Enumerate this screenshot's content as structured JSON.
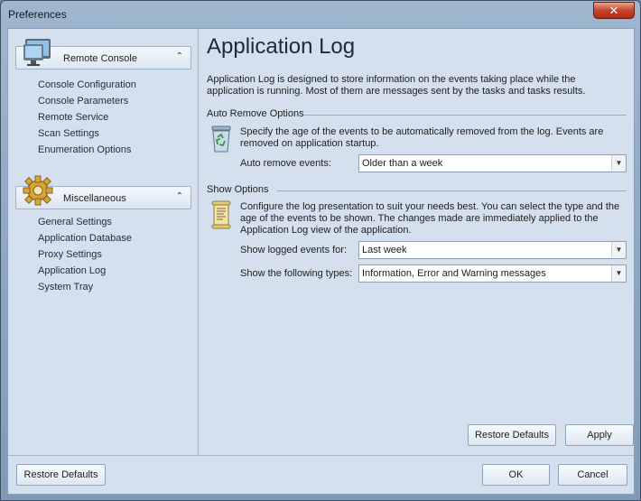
{
  "window": {
    "title": "Preferences",
    "close_label": "✕"
  },
  "sidebar": {
    "groups": [
      {
        "label": "Remote Console",
        "icon": "monitor-icon",
        "items": [
          "Console Configuration",
          "Console Parameters",
          "Remote Service",
          "Scan Settings",
          "Enumeration Options"
        ]
      },
      {
        "label": "Miscellaneous",
        "icon": "gear-icon",
        "items": [
          "General Settings",
          "Application Database",
          "Proxy Settings",
          "Application Log",
          "System Tray"
        ]
      }
    ],
    "collapse_glyph": "⌃"
  },
  "main": {
    "title": "Application Log",
    "description": "Application Log is designed to store information on the events taking place while the application is running. Most of them are messages sent by the tasks and tasks results.",
    "auto_remove": {
      "heading": "Auto Remove Options",
      "text": "Specify the age of the events to be automatically removed from the log. Events are removed on application startup.",
      "field_label": "Auto remove events:",
      "field_value": "Older than a week",
      "icon": "recycle-bin-icon"
    },
    "show_options": {
      "heading": "Show Options",
      "text": "Configure the log presentation to suit your needs best. You can select the type and the age of the events to be shown. The changes made are immediately applied to the Application Log view of the application.",
      "events_label": "Show logged events for:",
      "events_value": "Last week",
      "types_label": "Show the following types:",
      "types_value": "Information, Error and Warning messages",
      "icon": "log-document-icon"
    },
    "restore_defaults_label": "Restore Defaults",
    "apply_label": "Apply"
  },
  "footer": {
    "restore_defaults_label": "Restore Defaults",
    "ok_label": "OK",
    "cancel_label": "Cancel"
  },
  "colors": {
    "accent": "#d4e0ee",
    "title_bar": "#8fa8c4",
    "close": "#c8442c"
  }
}
